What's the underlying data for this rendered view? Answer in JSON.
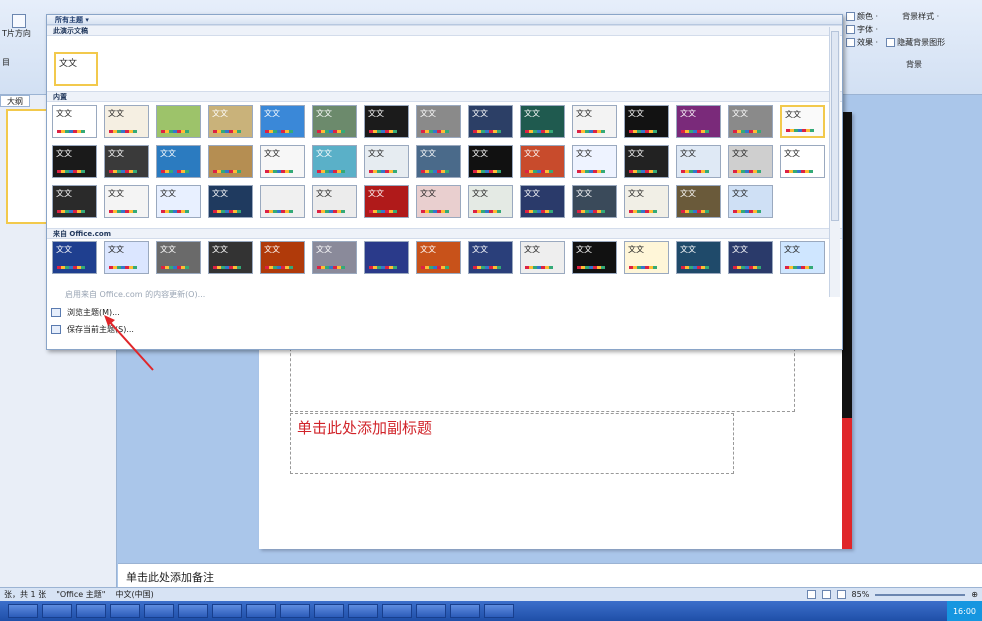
{
  "ribbon": {
    "left_label_1": "T片方向",
    "left_label_2": "目",
    "outline_tab": "大纲",
    "right": {
      "colors": "颜色 ·",
      "fonts": "字体 ·",
      "effects": "效果 ·",
      "bg_styles": "背景样式 ·",
      "hide_bg": "隐藏背景图形",
      "group_bg": "背景"
    }
  },
  "gallery": {
    "header": "所有主题 ▾",
    "section_current": "此演示文稿",
    "current_theme_label": "文文",
    "section_builtin": "内置",
    "section_office": "来自 Office.com",
    "tile_labels": [
      "文文",
      "文文",
      "",
      "文文",
      "文文",
      "文文",
      "文文",
      "文文",
      "文文",
      "文文",
      "文文",
      "文文",
      "文文",
      "文文",
      "文文",
      "文文"
    ],
    "menu": [
      {
        "label": "启用来自 Office.com 的内容更新(O)...",
        "disabled": true
      },
      {
        "label": "浏览主题(M)...",
        "disabled": false
      },
      {
        "label": "保存当前主题(S)...",
        "disabled": false
      }
    ]
  },
  "slide": {
    "subtitle_placeholder": "单击此处添加副标题"
  },
  "notes": {
    "placeholder": "单击此处添加备注"
  },
  "statusbar": {
    "slide_info": "张，共 1 张",
    "theme": "\"Office 主题\"",
    "language": "中文(中国)",
    "zoom": "85%"
  },
  "taskbar": {
    "time": "16:00"
  },
  "colors": {
    "accent_red": "#e0262a",
    "selection": "#f2c94c"
  }
}
